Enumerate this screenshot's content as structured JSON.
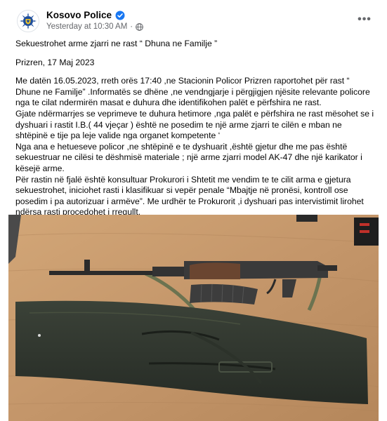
{
  "post": {
    "author": "Kosovo Police",
    "timestamp": "Yesterday at 10:30 AM",
    "meta_separator": "·",
    "more_label": "•••",
    "title_line": "Sekuestrohet  arme zjarri ne rast “ Dhuna ne Familje ”",
    "place_date": "Prizren, 17 Maj  2023",
    "body_paragraphs": [
      "Me datën 16.05.2023, rreth orës 17:40  ,ne Stacionin Policor Prizren raportohet për rast “ Dhune ne Familje” .Informatës se dhëne ,ne  vendngjarje  i përgjigjen njësite relevante policore nga te cilat ndermirën masat e duhura  dhe identifikohen palët e përfshira ne rast.",
      "Gjate ndërmarrjes se veprimeve te duhura hetimore ,nga palët e përfshira ne rast mësohet se i dyshuari i rastit I.B.( 44 vjeçar ) është ne posedim te një arme zjarri te cilën e mban ne shtëpinë e tije pa leje valide nga organet kompetente ‘",
      "Nga ana e hetueseve policor ,ne shtëpinë e te dyshuarit  ,është gjetur dhe me pas është sekuestruar ne cilësi te dëshmisë materiale  ; një arme zjarri  model AK-47  dhe një karikator i kësejë arme.",
      "Për rastin në fjalë është konsultuar  Prokurori i Shtetit me vendim te te cilit arma e gjetura sekuestrohet, iniciohet rasti i klasifikuar si vepër penale  “Mbajtje në pronësi,  kontroll ose posedim i pa autorizuar i armëve”. Me urdhër te Prokurorit ,i dyshuari pas intervistimit lirohet ndërsa rasti procedohet i rregullt."
    ]
  },
  "colors": {
    "verified": "#1877f2",
    "text": "#050505",
    "meta": "#65676b"
  },
  "icons": {
    "avatar": "kosovo-police-badge",
    "verified": "verified-badge-icon",
    "audience": "globe-icon",
    "more": "more-options-icon"
  }
}
